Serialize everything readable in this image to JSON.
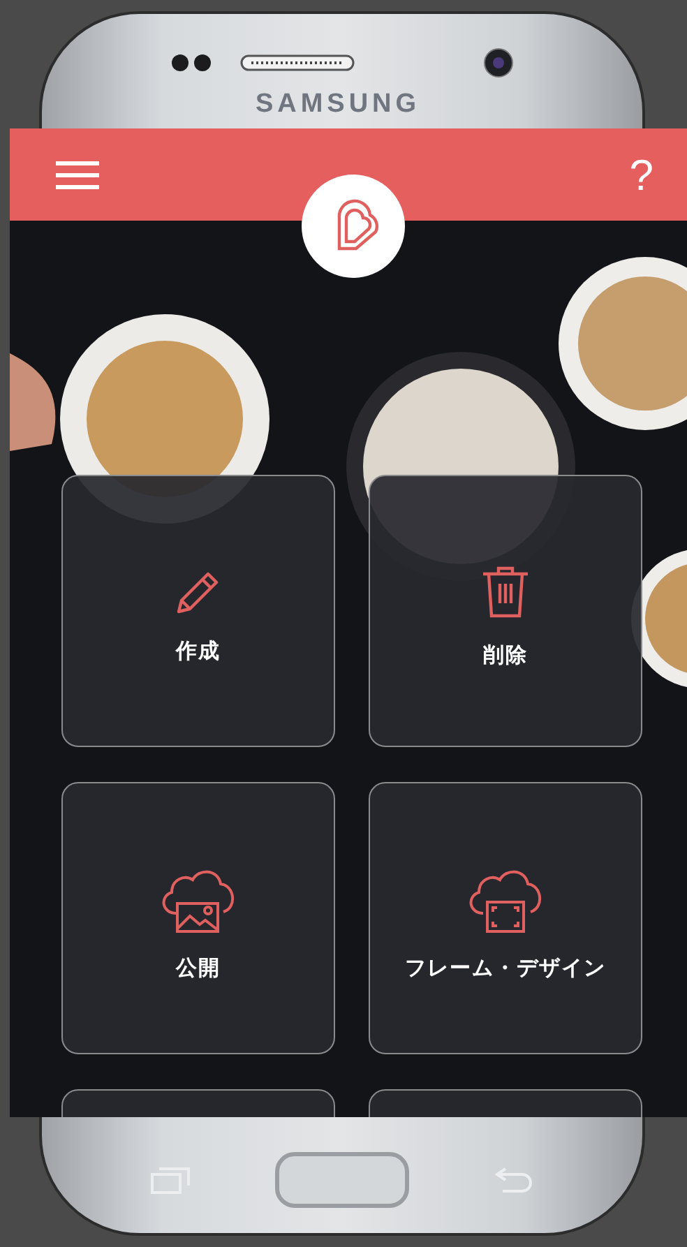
{
  "device": {
    "brand": "SAMSUNG"
  },
  "header": {
    "help": "?"
  },
  "tiles": [
    {
      "label": "作成",
      "kind": "create"
    },
    {
      "label": "削除",
      "kind": "delete"
    },
    {
      "label": "公開",
      "kind": "publish"
    },
    {
      "label": "フレーム・デザイン",
      "kind": "frame"
    }
  ]
}
